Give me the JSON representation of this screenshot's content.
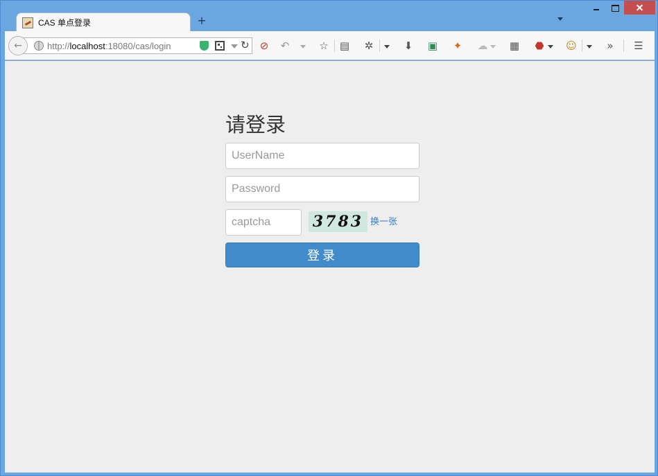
{
  "browser": {
    "tab_title": "CAS 单点登录",
    "new_tab_label": "+",
    "url_prefix": "http://",
    "url_host": "localhost",
    "url_rest": ":18080/cas/login",
    "toolbar_icons": [
      "no-script-icon",
      "undo-icon",
      "star-icon",
      "reader-icon",
      "bug-icon",
      "download-icon",
      "image-icon",
      "puzzle-icon",
      "share-icon",
      "grid-icon",
      "adblock-icon",
      "smiley-icon",
      "overflow-icon",
      "menu-icon"
    ]
  },
  "login": {
    "title": "请登录",
    "username_placeholder": "UserName",
    "password_placeholder": "Password",
    "captcha_placeholder": "captcha",
    "captcha_text": "3783",
    "refresh_label": "换一张",
    "submit_label": "登录"
  },
  "colors": {
    "frame": "#6aa6e0",
    "page_bg": "#eeeeee",
    "primary": "#428bca",
    "link": "#3a7bc8",
    "close_button": "#c74e4e"
  }
}
